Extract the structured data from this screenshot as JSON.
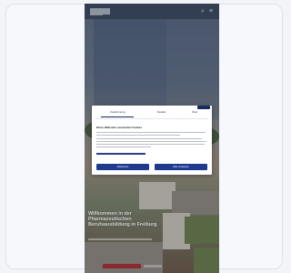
{
  "page": {
    "hero": {
      "headline": "Willkommen in der Pharmazeutischen Berufsausbildung in Freiburg"
    }
  },
  "cookie_dialog": {
    "tabs": [
      "Zustimmung",
      "Details",
      "Über"
    ],
    "heading": "Diese Webseite verwendet Cookies",
    "buttons": [
      "Ablehnen",
      "Alle zulassen"
    ]
  },
  "icons": [
    "search-icon",
    "menu-icon"
  ]
}
